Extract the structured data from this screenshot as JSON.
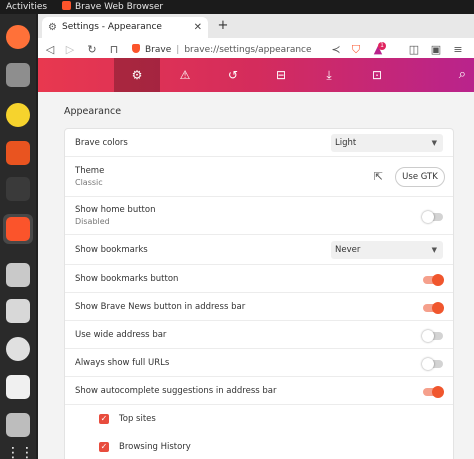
{
  "topbar": {
    "activities": "Activities",
    "app_name": "Brave Web Browser"
  },
  "dock": {
    "items": [
      {
        "name": "firefox-icon",
        "color": "#ff7139"
      },
      {
        "name": "files-icon",
        "color": "#8e8e8e"
      },
      {
        "name": "rhythmbox-icon",
        "color": "#f6d32d"
      },
      {
        "name": "app-center-icon",
        "color": "#e95420"
      },
      {
        "name": "terminal-icon",
        "color": "#3a3a3a"
      },
      {
        "name": "brave-icon",
        "color": "#fb542b"
      },
      {
        "name": "image-viewer-icon",
        "color": "#c9c9c9"
      },
      {
        "name": "text-editor-icon",
        "color": "#d8d8d8"
      },
      {
        "name": "disc-icon",
        "color": "#e0e0e0"
      },
      {
        "name": "document-viewer-icon",
        "color": "#f0f0f0"
      },
      {
        "name": "storage-icon",
        "color": "#bdbdbd"
      },
      {
        "name": "show-apps-icon",
        "color": "#ffffff"
      }
    ]
  },
  "tab": {
    "title": "Settings - Appearance"
  },
  "toolbar": {
    "brand": "Brave",
    "url": "brave://settings/appearance",
    "notification_count": "1"
  },
  "nav": {
    "icons": [
      "gear-icon",
      "shields-icon",
      "history-icon",
      "bookmarks-icon",
      "downloads-icon",
      "wallet-icon"
    ],
    "active_index": 0
  },
  "content": {
    "section_title": "Appearance",
    "brave_colors": {
      "label": "Brave colors",
      "value": "Light"
    },
    "theme": {
      "label": "Theme",
      "sub": "Classic",
      "button": "Use GTK"
    },
    "home_button": {
      "label": "Show home button",
      "sub": "Disabled",
      "on": false
    },
    "bookmarks": {
      "label": "Show bookmarks",
      "value": "Never"
    },
    "toggles": [
      {
        "label": "Show bookmarks button",
        "on": true
      },
      {
        "label": "Show Brave News button in address bar",
        "on": true
      },
      {
        "label": "Use wide address bar",
        "on": false
      },
      {
        "label": "Always show full URLs",
        "on": false
      },
      {
        "label": "Show autocomplete suggestions in address bar",
        "on": true
      }
    ],
    "checkboxes": [
      {
        "label": "Top sites",
        "checked": true
      },
      {
        "label": "Browsing History",
        "checked": true
      }
    ]
  },
  "colors": {
    "accent": "#f0562d",
    "nav_start": "#e8384f",
    "nav_end": "#b9238c"
  }
}
